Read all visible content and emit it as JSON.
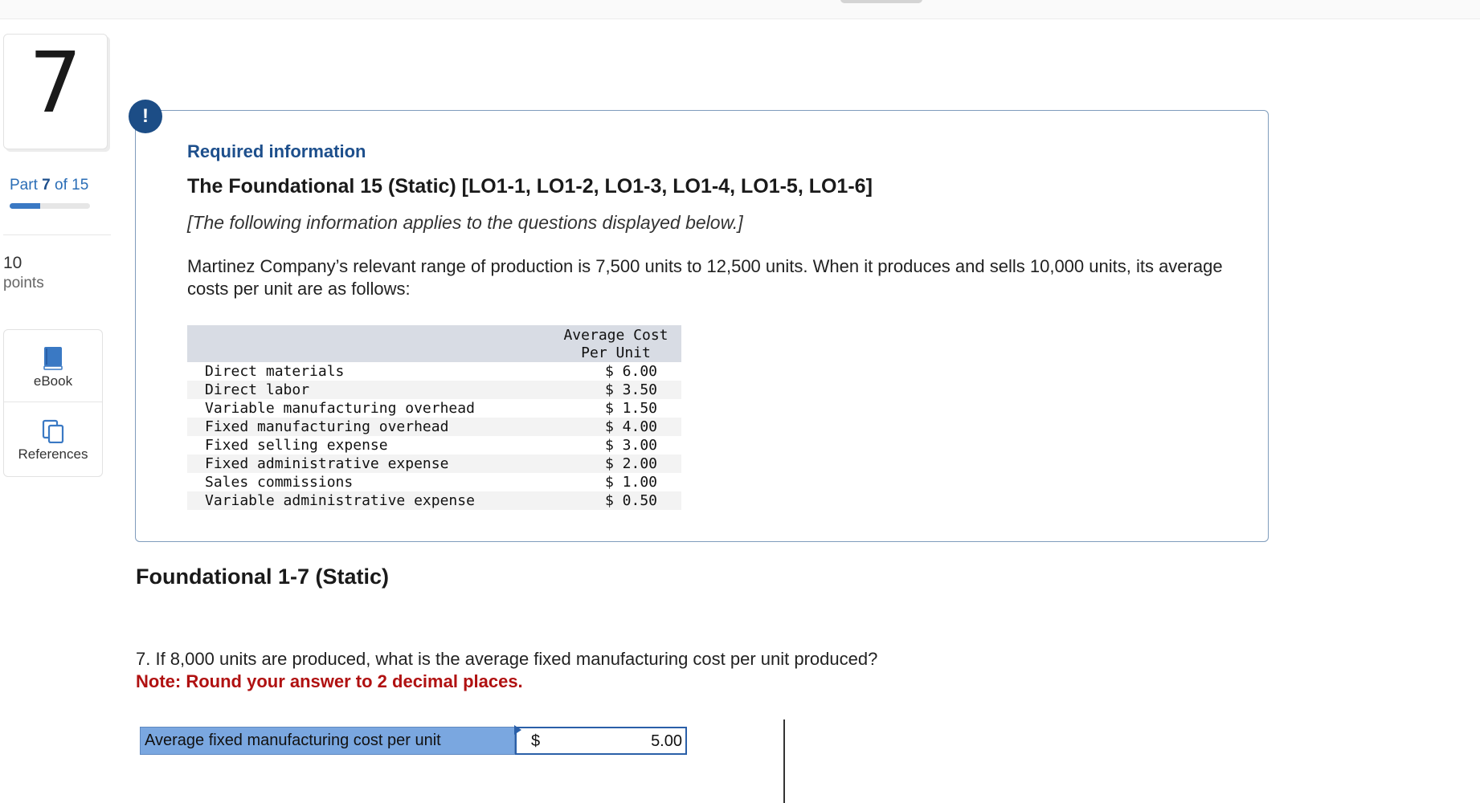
{
  "question": {
    "number": "7"
  },
  "progress": {
    "part_current": "7",
    "part_text": "Part",
    "part_of": "of 15",
    "fraction": 0.38
  },
  "points": {
    "value": "10",
    "label": "points"
  },
  "tools": [
    {
      "label": "eBook",
      "icon": "book-icon"
    },
    {
      "label": "References",
      "icon": "copy-icon"
    }
  ],
  "info": {
    "badge": "!",
    "heading": "Required information",
    "title": "The Foundational 15 (Static) [LO1-1, LO1-2, LO1-3, LO1-4, LO1-5, LO1-6]",
    "applies": "[The following information applies to the questions displayed below.]",
    "description": "Martinez Company’s relevant range of production is 7,500 units to 12,500 units. When it produces and sells 10,000 units, its average costs per unit are as follows:",
    "table": {
      "header_line1": "Average Cost",
      "header_line2": "Per Unit",
      "rows": [
        {
          "name": "Direct materials",
          "value": "$ 6.00"
        },
        {
          "name": "Direct labor",
          "value": "$ 3.50"
        },
        {
          "name": "Variable manufacturing overhead",
          "value": "$ 1.50"
        },
        {
          "name": "Fixed manufacturing overhead",
          "value": "$ 4.00"
        },
        {
          "name": "Fixed selling expense",
          "value": "$ 3.00"
        },
        {
          "name": "Fixed administrative expense",
          "value": "$ 2.00"
        },
        {
          "name": "Sales commissions",
          "value": "$ 1.00"
        },
        {
          "name": "Variable administrative expense",
          "value": "$ 0.50"
        }
      ]
    }
  },
  "section": {
    "title": "Foundational 1-7 (Static)",
    "question": "7. If 8,000 units are produced, what is the average fixed manufacturing cost per unit produced?",
    "note": "Note: Round your answer to 2 decimal places."
  },
  "answer": {
    "label": "Average fixed manufacturing cost per unit",
    "currency": "$",
    "value": "5.00"
  },
  "colors": {
    "accent": "#1c4d86",
    "link": "#2a6db6",
    "note": "#b01111",
    "answer_label_bg": "#7aa7e0"
  }
}
